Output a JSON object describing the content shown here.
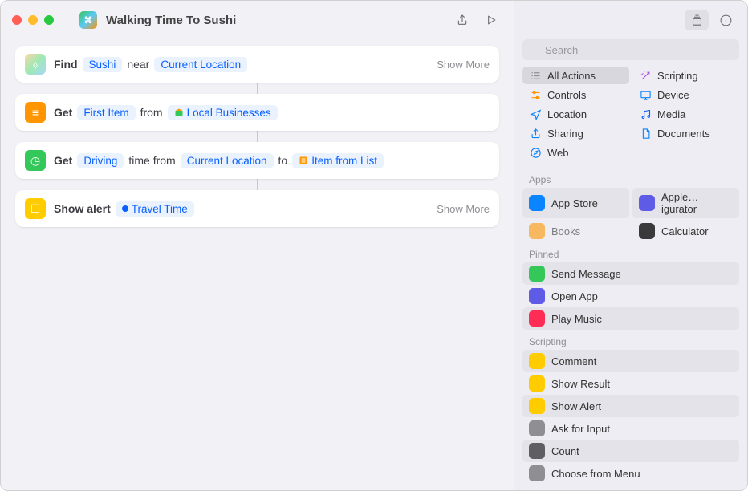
{
  "window": {
    "title": "Walking Time To Sushi"
  },
  "search": {
    "placeholder": "Search"
  },
  "actions": [
    {
      "icon": "maps",
      "parts": [
        {
          "t": "plain",
          "v": "Find"
        },
        {
          "t": "token",
          "v": "Sushi"
        },
        {
          "t": "plain-light",
          "v": "near"
        },
        {
          "t": "token",
          "v": "Current Location"
        }
      ],
      "show_more": "Show More"
    },
    {
      "icon": "orange",
      "parts": [
        {
          "t": "plain",
          "v": "Get"
        },
        {
          "t": "token",
          "v": "First Item"
        },
        {
          "t": "plain-light",
          "v": "from"
        },
        {
          "t": "token",
          "v": "Local Businesses",
          "ic": "biz"
        }
      ]
    },
    {
      "icon": "green",
      "parts": [
        {
          "t": "plain",
          "v": "Get"
        },
        {
          "t": "token",
          "v": "Driving"
        },
        {
          "t": "plain-light",
          "v": "time from"
        },
        {
          "t": "token",
          "v": "Current Location"
        },
        {
          "t": "plain-light",
          "v": "to"
        },
        {
          "t": "token",
          "v": "Item from List",
          "ic": "list"
        }
      ]
    },
    {
      "icon": "yellow",
      "parts": [
        {
          "t": "plain",
          "v": "Show alert"
        },
        {
          "t": "token",
          "v": "Travel Time",
          "ic": "dot"
        }
      ],
      "show_more": "Show More"
    }
  ],
  "categories": [
    {
      "label": "All Actions",
      "icon": "list3",
      "color": "#8e8e93",
      "selected": true
    },
    {
      "label": "Scripting",
      "icon": "wand",
      "color": "#af52de"
    },
    {
      "label": "Controls",
      "icon": "slider",
      "color": "#ff9500"
    },
    {
      "label": "Device",
      "icon": "display",
      "color": "#0a84ff"
    },
    {
      "label": "Location",
      "icon": "nav",
      "color": "#0a84ff"
    },
    {
      "label": "Media",
      "icon": "music",
      "color": "#0a60ff"
    },
    {
      "label": "Sharing",
      "icon": "share",
      "color": "#0a84ff"
    },
    {
      "label": "Documents",
      "icon": "doc",
      "color": "#0a84ff"
    },
    {
      "label": "Web",
      "icon": "safari",
      "color": "#0a84ff"
    }
  ],
  "sections": {
    "apps_label": "Apps",
    "apps": [
      {
        "label": "App Store",
        "bg": "#0a84ff"
      },
      {
        "label": "Apple…igurator",
        "bg": "#5e5ce6"
      },
      {
        "label": "Books",
        "bg": "#ff9500"
      },
      {
        "label": "Calculator",
        "bg": "#3a3a3c"
      }
    ],
    "pinned_label": "Pinned",
    "pinned": [
      {
        "label": "Send Message",
        "bg": "#34c759"
      },
      {
        "label": "Open App",
        "bg": "#5e5ce6"
      },
      {
        "label": "Play Music",
        "bg": "#ff2d55"
      }
    ],
    "scripting_label": "Scripting",
    "scripting": [
      {
        "label": "Comment",
        "bg": "#ffcc00"
      },
      {
        "label": "Show Result",
        "bg": "#ffcc00"
      },
      {
        "label": "Show Alert",
        "bg": "#ffcc00"
      },
      {
        "label": "Ask for Input",
        "bg": "#8e8e93"
      },
      {
        "label": "Count",
        "bg": "#5e5e63"
      },
      {
        "label": "Choose from Menu",
        "bg": "#8e8e93"
      }
    ]
  }
}
